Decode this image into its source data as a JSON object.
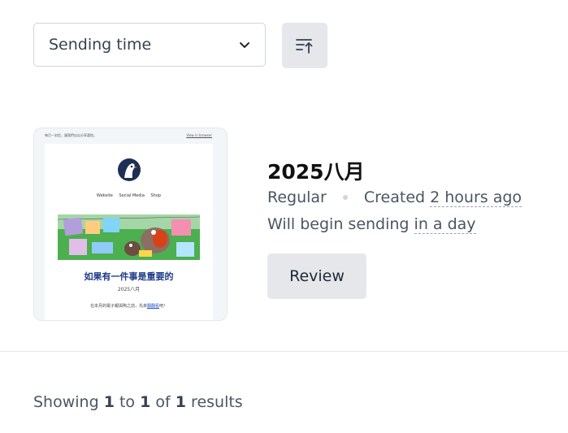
{
  "sort": {
    "selected": "Sending time",
    "icon": "chevron-down-icon",
    "direction_icon": "sort-ascending-icon"
  },
  "campaign": {
    "title": "2025八月",
    "type": "Regular",
    "created_label": "Created",
    "created_time": "2 hours ago",
    "status_prefix": "Will begin sending",
    "status_time": "in a day",
    "review_label": "Review",
    "thumbnail": {
      "top_left": "每月一封信，讓我們瓜瓜分享喜悅。",
      "top_right": "View in browser",
      "links": [
        "Website",
        "Social Media",
        "Shop"
      ],
      "heading": "如果有一件事是重要的",
      "date": "2025八月",
      "body_prefix": "在本月的電子報與陶之前，先來",
      "body_link": "翻翻看",
      "body_suffix": "吧！"
    }
  },
  "footer": {
    "prefix": "Showing",
    "from": "1",
    "to_word": "to",
    "to": "1",
    "of_word": "of",
    "total": "1",
    "suffix": "results"
  },
  "colors": {
    "button_bg": "#e5e7eb",
    "border": "#d1d5db",
    "text": "#374151"
  }
}
